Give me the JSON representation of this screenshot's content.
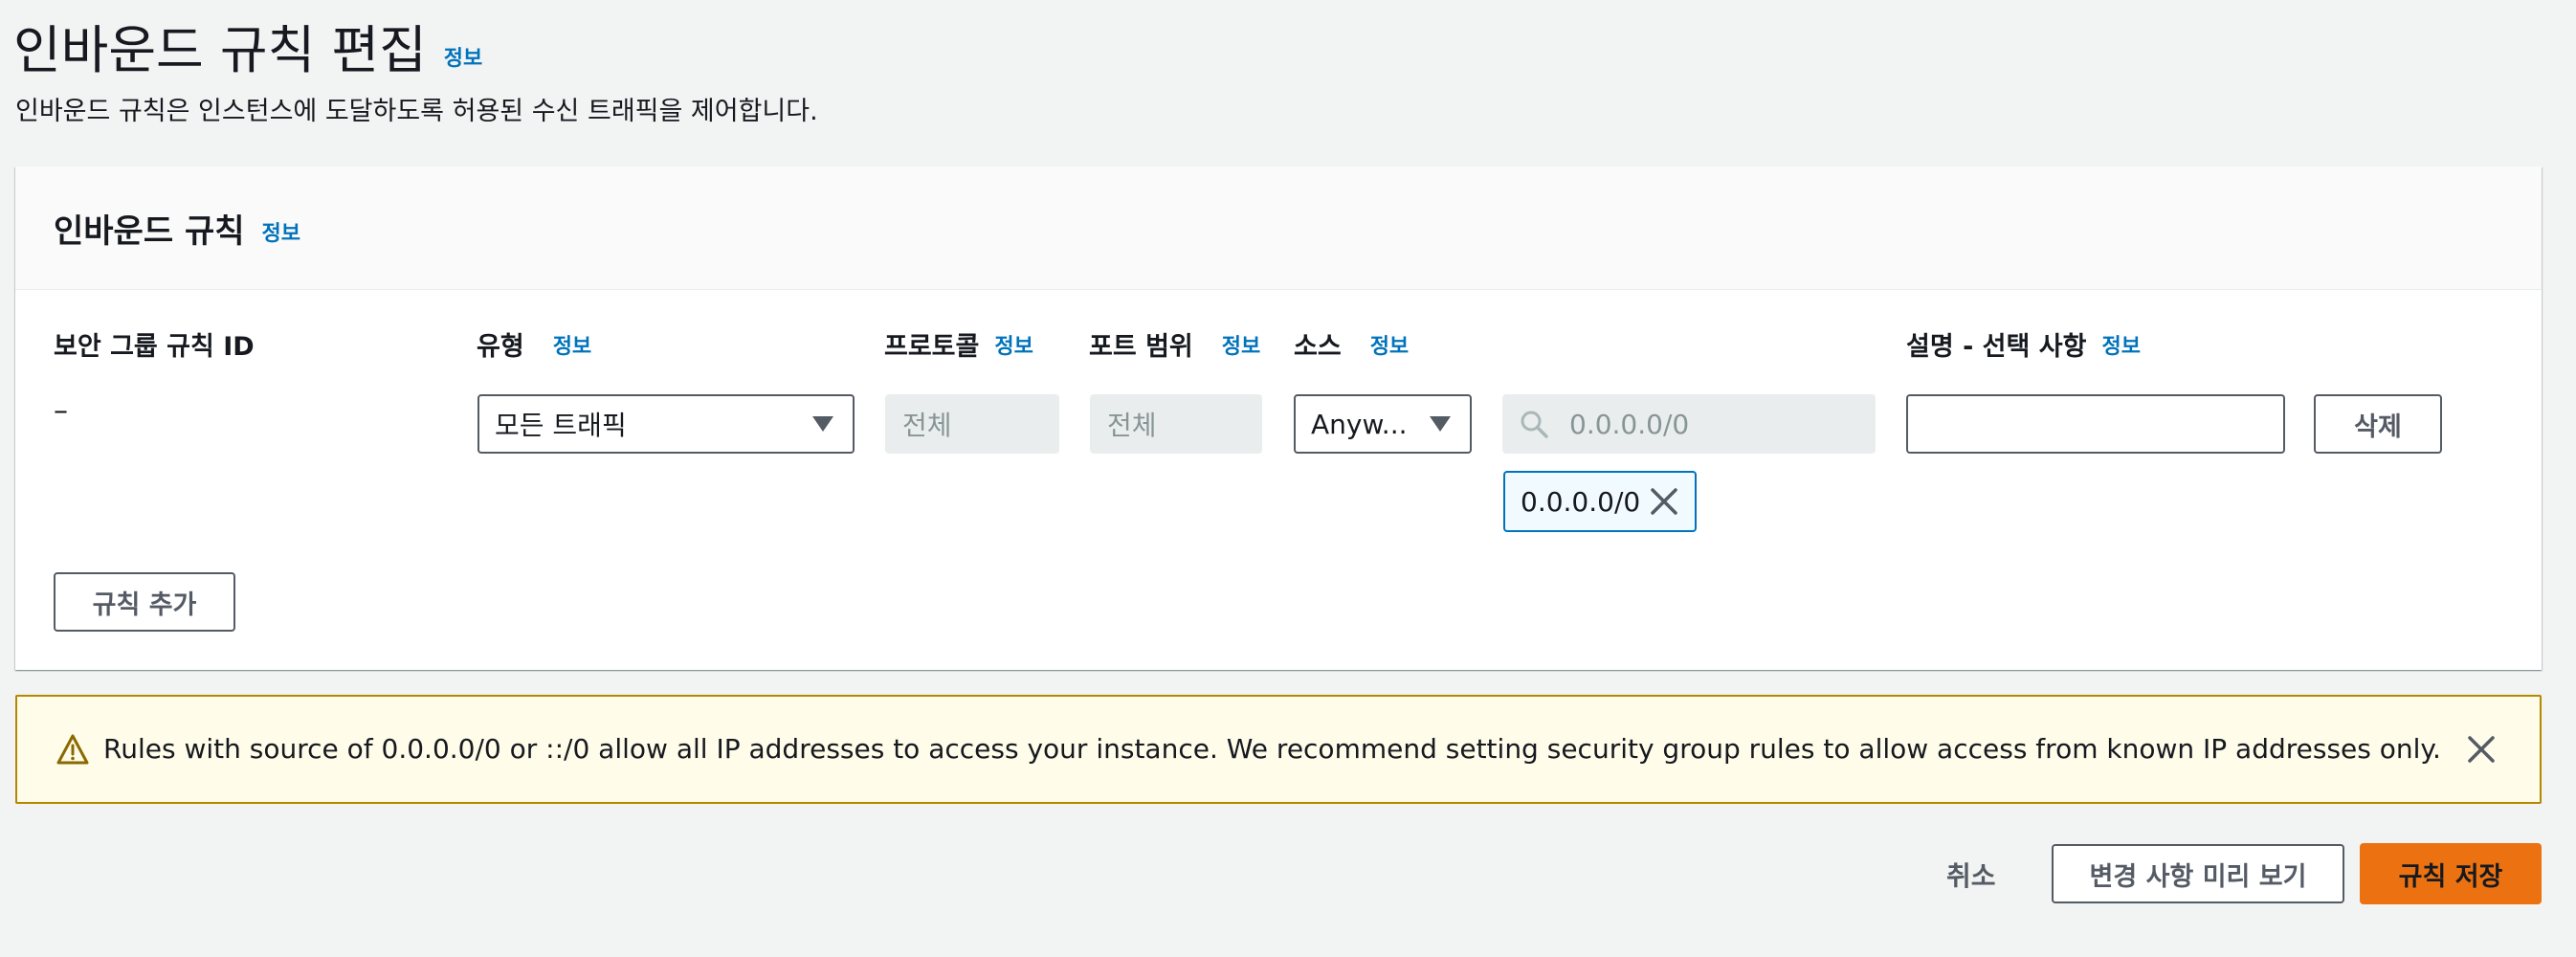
{
  "page": {
    "title": "인바운드 규칙 편집",
    "title_info": "정보",
    "description": "인바운드 규칙은 인스턴스에 도달하도록 허용된 수신 트래픽을 제어합니다."
  },
  "panel": {
    "title": "인바운드 규칙",
    "title_info": "정보",
    "columns": {
      "rule_id": "보안 그룹 규칙 ID",
      "type": "유형",
      "type_info": "정보",
      "protocol": "프로토콜",
      "protocol_info": "정보",
      "port_range": "포트 범위",
      "port_range_info": "정보",
      "source": "소스",
      "source_info": "정보",
      "description": "설명 - 선택 사항",
      "description_info": "정보"
    },
    "rule": {
      "rule_id": "–",
      "type_value": "모든 트래픽",
      "protocol_value": "전체",
      "port_range_value": "전체",
      "source_value": "Anyw...",
      "source_search_placeholder": "0.0.0.0/0",
      "source_token": "0.0.0.0/0",
      "description_value": "",
      "delete_label": "삭제"
    },
    "add_rule_label": "규칙 추가"
  },
  "alert": {
    "message": "Rules with source of 0.0.0.0/0 or ::/0 allow all IP addresses to access your instance. We recommend setting security group rules to allow access from known IP addresses only."
  },
  "footer": {
    "cancel_label": "취소",
    "preview_label": "변경 사항 미리 보기",
    "save_label": "규칙 저장"
  },
  "colors": {
    "link": "#0073bb",
    "primary": "#ec7211",
    "warning_bg": "#fffce9",
    "warning_border": "#b48900"
  }
}
